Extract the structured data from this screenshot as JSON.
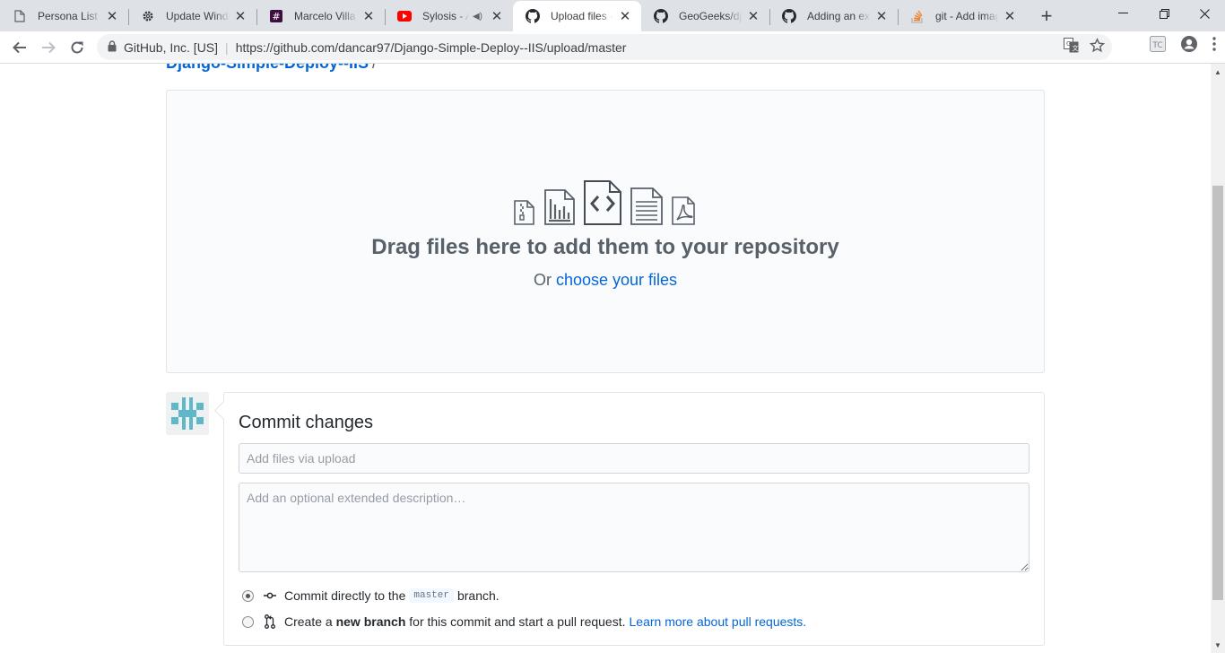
{
  "browser": {
    "tabs": [
      {
        "title": "Persona List – ",
        "icon": "document-icon",
        "active": false
      },
      {
        "title": "Update Windo",
        "icon": "gear-icon",
        "active": false
      },
      {
        "title": "Marcelo Villa |",
        "icon": "slack-icon",
        "active": false
      },
      {
        "title": "Sylosis - A",
        "icon": "youtube-icon",
        "active": false,
        "audio": true
      },
      {
        "title": "Upload files · d",
        "icon": "github-icon",
        "active": true
      },
      {
        "title": "GeoGeeks/dja",
        "icon": "github-icon",
        "active": false
      },
      {
        "title": "Adding an exis",
        "icon": "github-icon",
        "active": false
      },
      {
        "title": "git - Add imag",
        "icon": "stackoverflow-icon",
        "active": false
      }
    ],
    "site_org": "GitHub, Inc. [US]",
    "url": "https://github.com/dancar97/Django-Simple-Deploy--IIS/upload/master"
  },
  "page": {
    "repo_name": "Django-Simple-Deploy--IIS",
    "repo_sep": "/",
    "drop_title": "Drag files here to add them to your repository",
    "drop_or": "Or",
    "choose_files": "choose your files",
    "commit_title": "Commit changes",
    "summary_placeholder": "Add files via upload",
    "description_placeholder": "Add an optional extended description…",
    "option_direct": {
      "prefix": "Commit directly to the",
      "branch": "master",
      "suffix": "branch.",
      "checked": true
    },
    "option_new_branch": {
      "prefix": "Create a",
      "bold": "new branch",
      "suffix": "for this commit and start a pull request.",
      "link": "Learn more about pull requests.",
      "checked": false
    }
  },
  "colors": {
    "link": "#0366d6",
    "avatar": "#5fb8c8"
  }
}
